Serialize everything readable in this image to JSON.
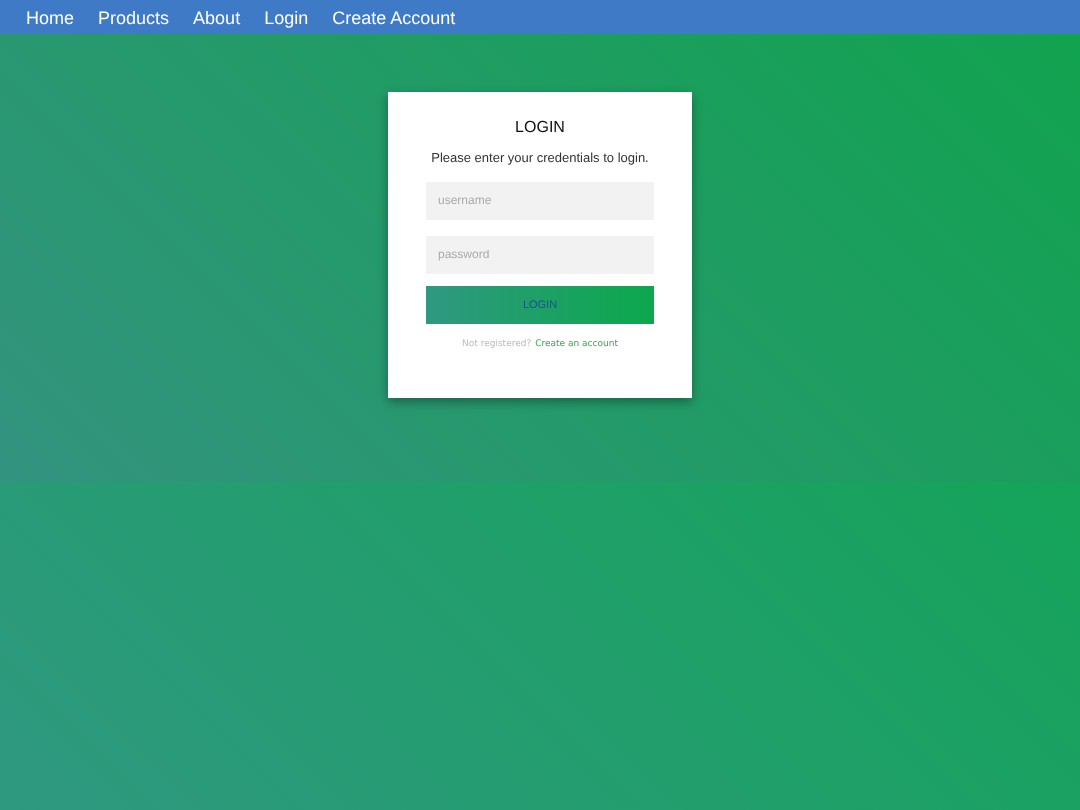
{
  "nav": [
    {
      "label": "Home"
    },
    {
      "label": "Products"
    },
    {
      "label": "About"
    },
    {
      "label": "Login"
    },
    {
      "label": "Create Account"
    }
  ],
  "form": {
    "title": "LOGIN",
    "subtitle": "Please enter your credentials to login.",
    "username_placeholder": "username",
    "password_placeholder": "password",
    "button": "LOGIN",
    "footer_text": "Not registered?",
    "footer_link": "Create an account"
  }
}
